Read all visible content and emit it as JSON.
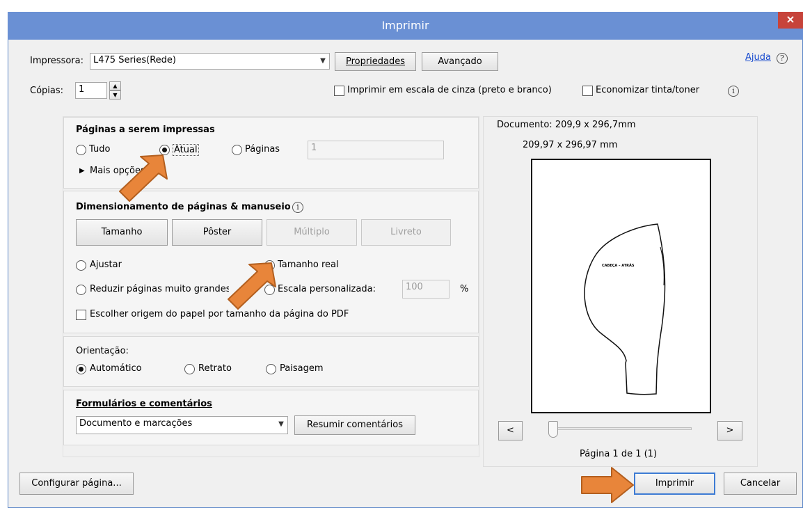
{
  "window": {
    "title": "Imprimir",
    "close_glyph": "×"
  },
  "printer": {
    "label": "Impressora:",
    "selected": "L475 Series(Rede)",
    "properties_button": "Propriedades",
    "advanced_button": "Avançado",
    "help_link": "Ajuda",
    "help_glyph": "?"
  },
  "copies": {
    "label": "Cópias:",
    "value": "1"
  },
  "options": {
    "grayscale_label": "Imprimir em escala de cinza (preto e branco)",
    "grayscale_checked": false,
    "save_ink_label": "Economizar tinta/toner",
    "save_ink_checked": false,
    "info_glyph": "i"
  },
  "pages_section": {
    "title": "Páginas a serem impressas",
    "all_label": "Tudo",
    "current_label": "Atual",
    "pages_label": "Páginas",
    "pages_input": "1",
    "selected": "current",
    "more_options": "Mais opções"
  },
  "sizing_section": {
    "title": "Dimensionamento de páginas & manuseio",
    "tab_size": "Tamanho",
    "tab_poster": "Pôster",
    "tab_multiple": "Múltiplo",
    "tab_booklet": "Livreto",
    "fit_label": "Ajustar",
    "actual_size_label": "Tamanho real",
    "shrink_label": "Reduzir páginas muito grandes",
    "custom_scale_label": "Escala personalizada:",
    "custom_scale_value": "100",
    "percent": "%",
    "paper_source_label": "Escolher origem do papel por tamanho da página do PDF",
    "selected": "actual"
  },
  "orientation_section": {
    "title": "Orientação:",
    "auto_label": "Automático",
    "portrait_label": "Retrato",
    "landscape_label": "Paisagem",
    "selected": "auto"
  },
  "forms_section": {
    "title": "Formulários e comentários",
    "selected": "Documento e marcações",
    "summarize_button": "Resumir comentários"
  },
  "preview": {
    "document_size": "Documento: 209,9 x 296,7mm",
    "page_size": "209,97 x 296,97 mm",
    "page_text": "CABEÇA – ATRÁS",
    "prev_button": "<",
    "next_button": ">",
    "page_indicator": "Página 1 de 1 (1)"
  },
  "footer": {
    "setup_button": "Configurar página...",
    "print_button": "Imprimir",
    "cancel_button": "Cancelar"
  },
  "colors": {
    "titlebar": "#6a90d4",
    "arrow": "#e8853a",
    "close": "#c7433a"
  }
}
